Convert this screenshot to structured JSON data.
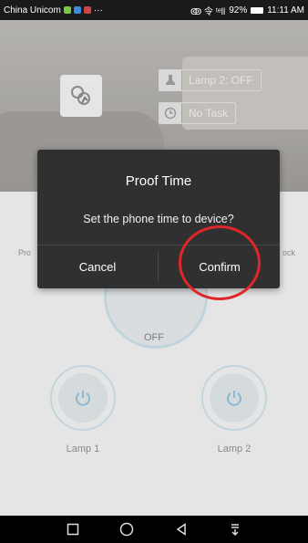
{
  "status_bar": {
    "carrier": "China Unicom",
    "extra": "···",
    "signal": "ↂ 令 ᵗᵉll",
    "battery": "92%",
    "time": "11:11 AM"
  },
  "header": {
    "lamp_status": "Lamp 2: OFF",
    "task_status": "No Task"
  },
  "main": {
    "left_label": "Pro",
    "right_label": "ock",
    "power_state": "OFF",
    "lamps": [
      {
        "label": "Lamp 1"
      },
      {
        "label": "Lamp 2"
      }
    ]
  },
  "dialog": {
    "title": "Proof Time",
    "message": "Set the phone time to device?",
    "cancel_label": "Cancel",
    "confirm_label": "Confirm"
  },
  "colors": {
    "dialog_bg": "#303030",
    "highlight_circle": "#e0262a",
    "lamp_ring": "#dbeef8"
  }
}
